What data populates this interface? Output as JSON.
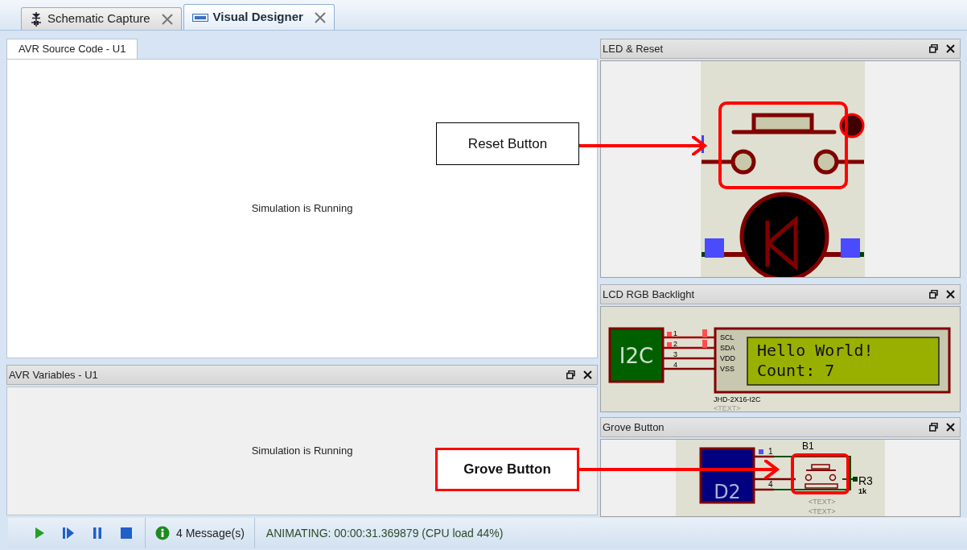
{
  "document_tabs": [
    {
      "label": "Schematic Capture",
      "selected": false,
      "kind": "schematic"
    },
    {
      "label": "Visual Designer",
      "selected": true,
      "kind": "designer"
    }
  ],
  "source_panel": {
    "tab": "AVR Source Code - U1",
    "message": "Simulation is Running"
  },
  "variables_panel": {
    "title": "AVR Variables - U1",
    "message": "Simulation is Running"
  },
  "led_panel": {
    "title": "LED & Reset"
  },
  "lcd_panel": {
    "title": "LCD RGB Backlight",
    "module_label": "I2C",
    "pins": [
      {
        "number": "1",
        "name": "SCL",
        "active": true
      },
      {
        "number": "2",
        "name": "SDA",
        "active": true
      },
      {
        "number": "3",
        "name": "VDD",
        "active": false
      },
      {
        "number": "4",
        "name": "VSS",
        "active": false
      }
    ],
    "display_lines": [
      "Hello World!",
      "Count: 7"
    ],
    "part_name": "JHD-2X16-I2C",
    "part_text": "<TEXT>"
  },
  "grove_panel": {
    "title": "Grove Button",
    "module_label": "D2",
    "pin_numbers": [
      "1",
      "4"
    ],
    "button_label": "B1",
    "resistor_label": "R3",
    "resistor_value": "1k",
    "texts": [
      "<TEXT>",
      "<TEXT>"
    ]
  },
  "callouts": [
    {
      "text": "Reset Button",
      "kind": "plain"
    },
    {
      "text": "Grove Button",
      "kind": "emphasis"
    }
  ],
  "toolbar": {
    "buttons": [
      {
        "kind": "play"
      },
      {
        "kind": "step"
      },
      {
        "kind": "pause"
      },
      {
        "kind": "stop"
      }
    ],
    "messages": "4 Message(s)",
    "status": "ANIMATING: 00:00:31.369879 (CPU load 44%)"
  }
}
